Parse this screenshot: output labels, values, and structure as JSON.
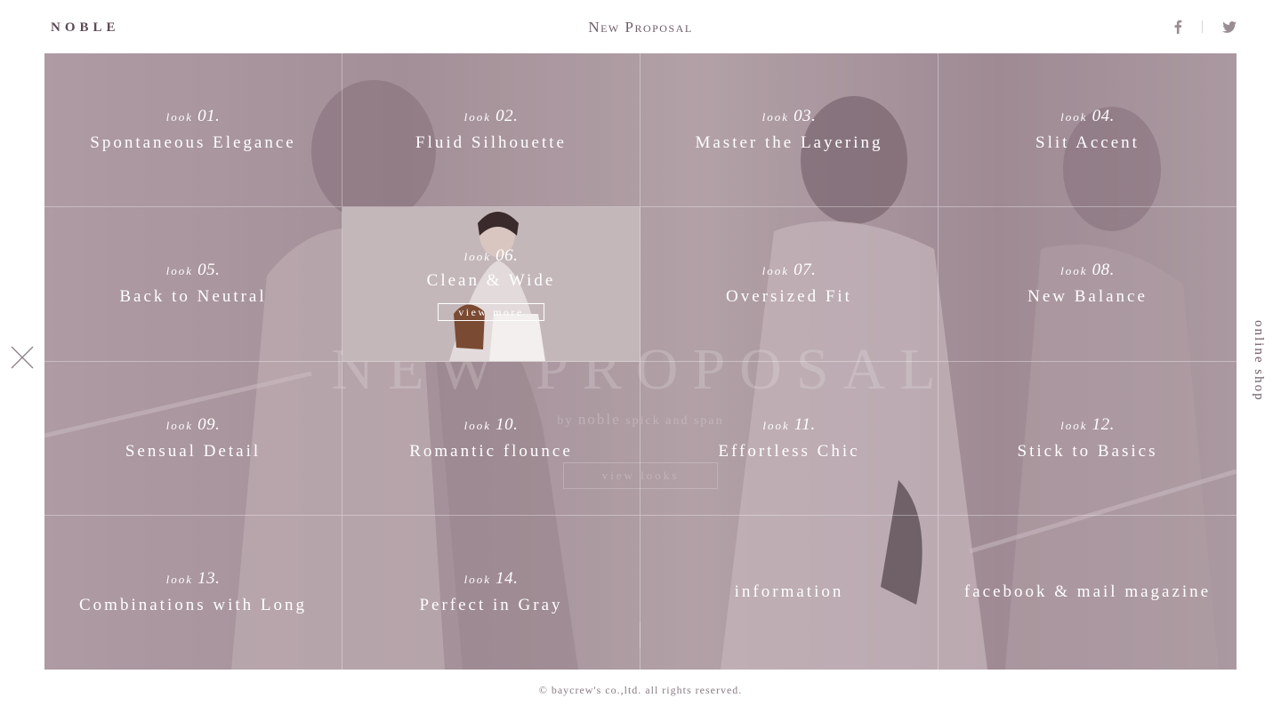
{
  "header": {
    "logo": "NOBLE",
    "title": "New Proposal",
    "social": [
      {
        "name": "facebook-icon"
      },
      {
        "name": "twitter-icon"
      }
    ]
  },
  "hero": {
    "title": "NEW PROPOSAL",
    "by": "by",
    "brand": "noble",
    "brand_suffix": "spick and span",
    "view_looks": "view looks"
  },
  "looks": [
    {
      "prefix": "look",
      "no": "01.",
      "title": "Spontaneous Elegance"
    },
    {
      "prefix": "look",
      "no": "02.",
      "title": "Fluid Silhouette"
    },
    {
      "prefix": "look",
      "no": "03.",
      "title": "Master the Layering"
    },
    {
      "prefix": "look",
      "no": "04.",
      "title": "Slit Accent"
    },
    {
      "prefix": "look",
      "no": "05.",
      "title": "Back to Neutral"
    },
    {
      "prefix": "look",
      "no": "06.",
      "title": "Clean & Wide",
      "view_more": "view more"
    },
    {
      "prefix": "look",
      "no": "07.",
      "title": "Oversized Fit"
    },
    {
      "prefix": "look",
      "no": "08.",
      "title": "New Balance"
    },
    {
      "prefix": "look",
      "no": "09.",
      "title": "Sensual Detail"
    },
    {
      "prefix": "look",
      "no": "10.",
      "title": "Romantic flounce"
    },
    {
      "prefix": "look",
      "no": "11.",
      "title": "Effortless Chic"
    },
    {
      "prefix": "look",
      "no": "12.",
      "title": "Stick to Basics"
    },
    {
      "prefix": "look",
      "no": "13.",
      "title": "Combinations with Long"
    },
    {
      "prefix": "look",
      "no": "14.",
      "title": "Perfect in Gray"
    }
  ],
  "links": {
    "information": "information",
    "facebook_mail": "facebook & mail magazine"
  },
  "side": {
    "online_shop": "online shop"
  },
  "footer": {
    "copyright": "© baycrew's co.,ltd. all rights reserved."
  }
}
